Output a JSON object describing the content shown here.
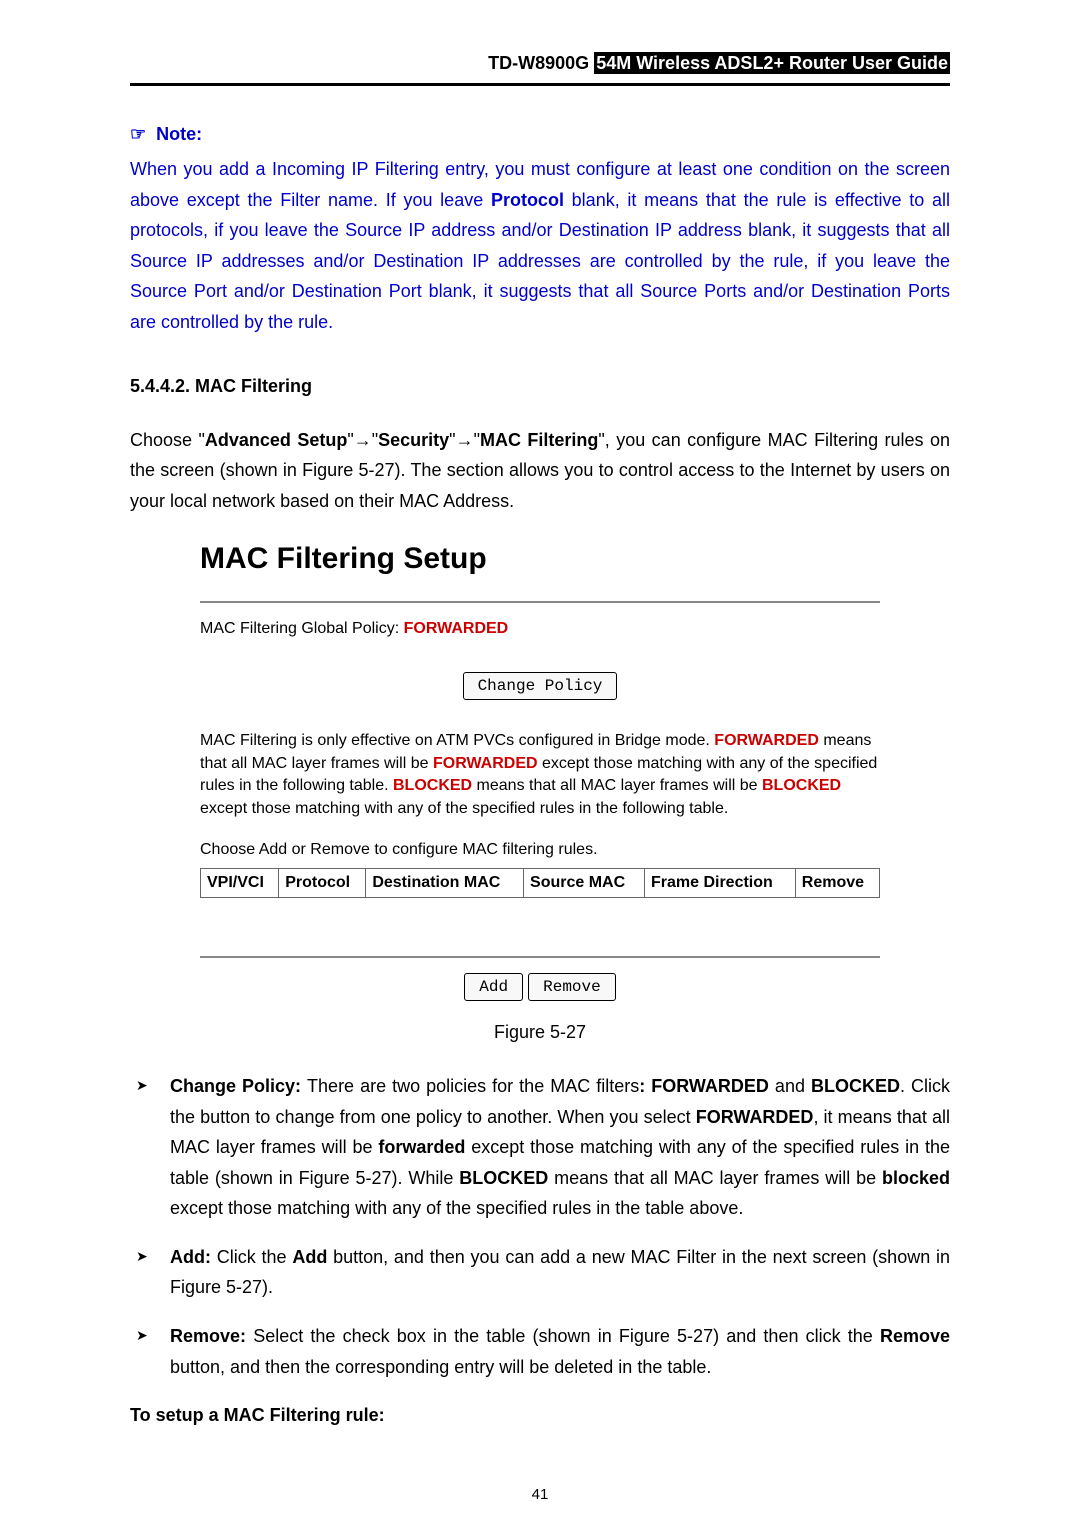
{
  "header": {
    "model": "TD-W8900G",
    "title": "54M  Wireless  ADSL2+  Router  User  Guide"
  },
  "note": {
    "heading": "Note:",
    "body_prefix": "When you add a Incoming IP Filtering entry, you must configure at least one condition on the screen above except the Filter name. If you leave ",
    "body_protocol": "Protocol",
    "body_suffix": " blank, it means that the rule is effective to all protocols, if you leave the Source IP address and/or Destination IP address blank, it suggests that all Source IP addresses and/or Destination IP addresses are controlled by the rule, if you leave the Source Port and/or Destination Port blank, it suggests that all Source Ports and/or Destination Ports are controlled by the rule."
  },
  "section": {
    "number": "5.4.4.2.  MAC Filtering",
    "p1a": "Choose \"",
    "p1b": "Advanced Setup",
    "p1c": "\"",
    "arrow": "→",
    "p1d": "\"",
    "p1e": "Security",
    "p1f": "\"",
    "p1g": "\"",
    "p1h": "MAC Filtering",
    "p1i": "\", you can configure MAC Filtering rules on the screen (shown in Figure 5-27). The section allows you to control access to the Internet by users on your local network based on their MAC Address."
  },
  "figure": {
    "title": "MAC Filtering Setup",
    "policy_label": "MAC Filtering Global Policy: ",
    "policy_value": "FORWARDED",
    "change_policy_btn": "Change Policy",
    "desc_1": "MAC Filtering is only effective on ATM PVCs configured in Bridge mode. ",
    "desc_forwarded": "FORWARDED",
    "desc_2": " means that all MAC layer frames will be ",
    "desc_3": " except those matching with any of the specified rules in the following table. ",
    "desc_blocked": "BLOCKED",
    "desc_4": " means that all MAC layer frames will be ",
    "desc_5": " except those matching with any of the specified rules in the following table.",
    "choose_text": "Choose Add or Remove to configure MAC filtering rules.",
    "headers": [
      "VPI/VCI",
      "Protocol",
      "Destination MAC",
      "Source MAC",
      "Frame Direction",
      "Remove"
    ],
    "add_btn": "Add",
    "remove_btn": "Remove",
    "caption": "Figure 5-27"
  },
  "bullets": {
    "b1_head": "Change Policy: ",
    "b1a": "There are two policies for the MAC filters",
    "b1b": ": FORWARDED",
    "b1c": " and ",
    "b1d": "BLOCKED",
    "b1e": ". Click the button to change from one policy to another. When you select ",
    "b1f": "FORWARDED",
    "b1g": ", it means that all MAC layer frames will be ",
    "b1h": "forwarded",
    "b1i": " except those matching with any of the specified rules in the table (shown in Figure 5-27). While ",
    "b1j": "BLOCKED",
    "b1k": " means that all MAC layer frames will be ",
    "b1l": "blocked",
    "b1m": " except those matching with any of the specified rules in the table above.",
    "b2_head": "Add: ",
    "b2a": "Click the ",
    "b2b": "Add",
    "b2c": " button, and then you can add a new MAC Filter in the next screen (shown in Figure 5-27).",
    "b3_head": "Remove: ",
    "b3a": "Select the check box in the table (shown in Figure 5-27) and then click the ",
    "b3b": "Remove",
    "b3c": " button, and then the corresponding entry will be deleted in the table."
  },
  "setup_head": "To setup a MAC Filtering rule:",
  "pagenum": "41"
}
